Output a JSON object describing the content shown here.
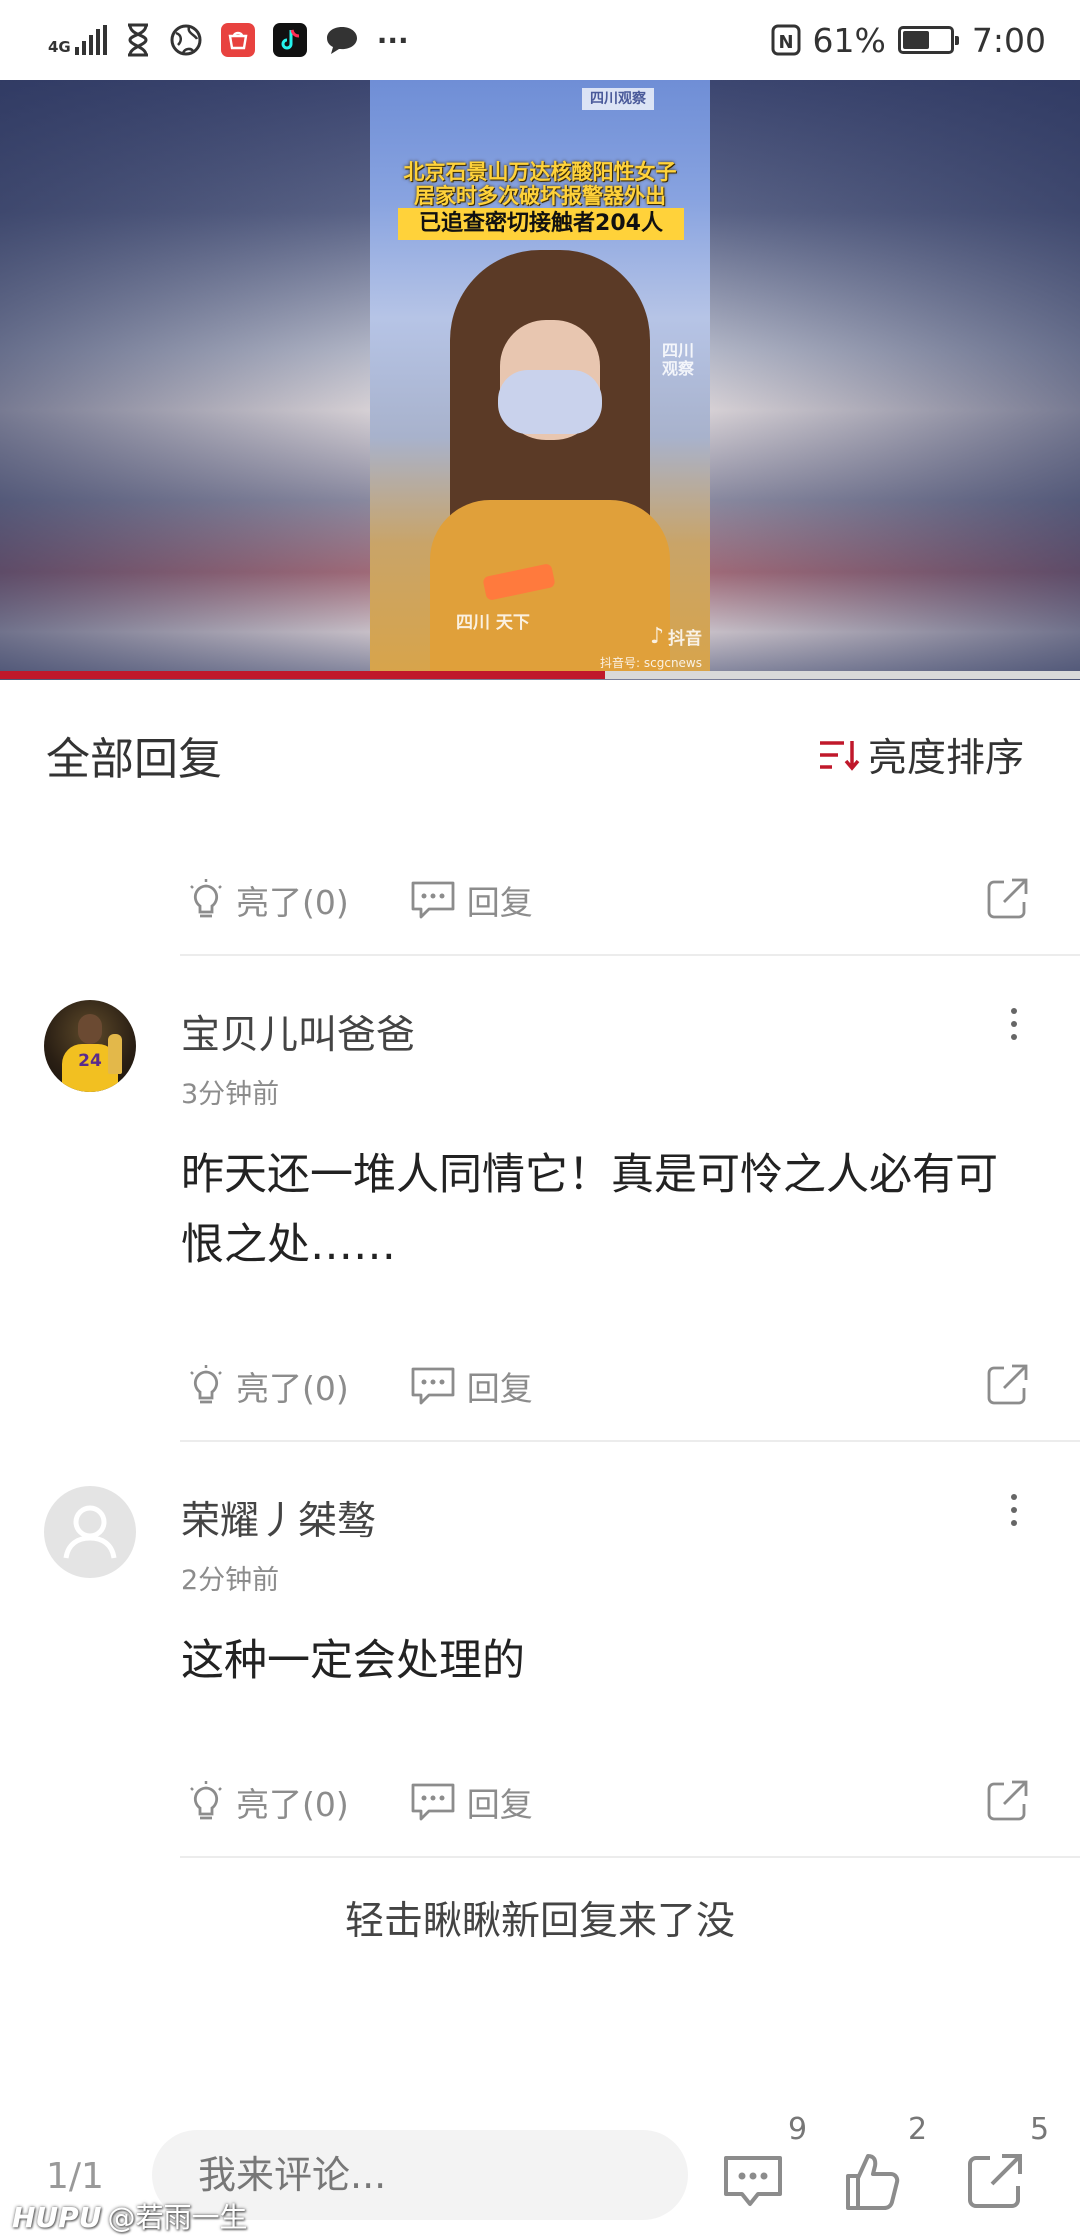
{
  "status_bar": {
    "network": "4G",
    "battery_percent": "61%",
    "time": "7:00",
    "overflow": "···",
    "nfc": "N",
    "icons": [
      "signal-icon",
      "hourglass-icon",
      "globe-icon",
      "appgallery-icon",
      "tiktok-icon",
      "chat-bubble-icon",
      "nfc-icon",
      "battery-icon"
    ],
    "battery_level": 0.61
  },
  "video": {
    "caption_line1": "北京石景山万达核酸阳性女子",
    "caption_line2": "居家时多次破坏报警器外出",
    "caption_highlight": "已追查密切接触者204人",
    "channel_logo": "四川观察",
    "watermark_side": "四川观察",
    "watermark_bottom": "四川 天下",
    "tiktok_label": "抖音",
    "tiktok_id": "抖音号: scgcnews",
    "progress": 0.56,
    "progress_color": "#c0182b"
  },
  "section": {
    "title": "全部回复",
    "sort_label": "亮度排序",
    "sort_icon_color": "#c0182b"
  },
  "action_labels": {
    "light": "亮了(0)",
    "reply": "回复"
  },
  "comments": [
    {
      "username": "宝贝儿叫爸爸",
      "time": "3分钟前",
      "text": "昨天还一堆人同情它！真是可怜之人必有可恨之处……",
      "avatar_jersey": "24"
    },
    {
      "username": "荣耀丿桀骜",
      "time": "2分钟前",
      "text": "这种一定会处理的"
    }
  ],
  "load_new": "轻击瞅瞅新回复来了没",
  "bottom_bar": {
    "page_indicator": "1/1",
    "input_placeholder": "我来评论...",
    "comment_count": "9",
    "like_count": "2",
    "share_count": "5"
  },
  "watermark": {
    "brand": "HUPU",
    "user": "@若雨一生"
  }
}
